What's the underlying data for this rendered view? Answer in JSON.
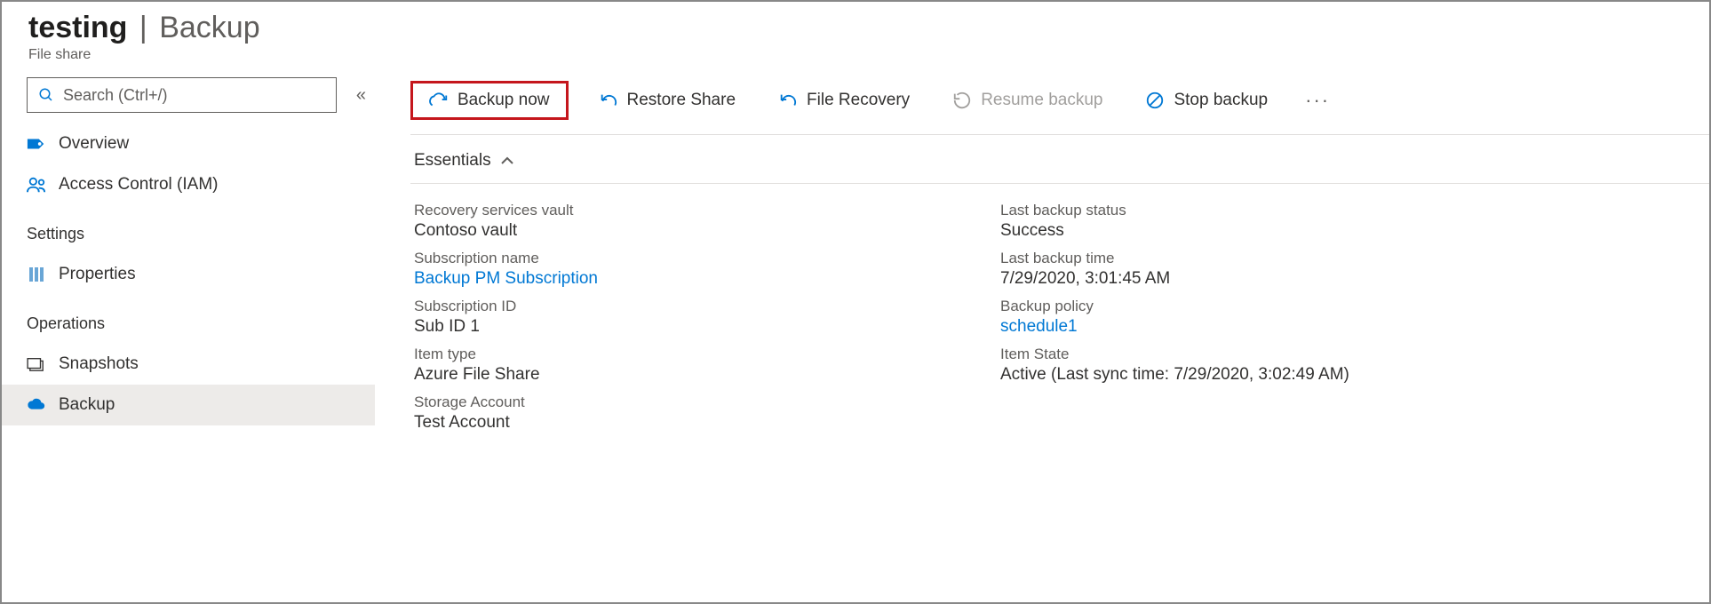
{
  "header": {
    "title_strong": "testing",
    "title_page": "Backup",
    "subtitle": "File share"
  },
  "search": {
    "placeholder": "Search (Ctrl+/)"
  },
  "sidebar": {
    "items": [
      {
        "label": "Overview",
        "icon": "tag-icon"
      },
      {
        "label": "Access Control (IAM)",
        "icon": "people-icon"
      }
    ],
    "group_settings": "Settings",
    "settings_items": [
      {
        "label": "Properties",
        "icon": "properties-icon"
      }
    ],
    "group_operations": "Operations",
    "operations_items": [
      {
        "label": "Snapshots",
        "icon": "snapshot-icon"
      },
      {
        "label": "Backup",
        "icon": "cloud-backup-icon",
        "selected": true
      }
    ]
  },
  "toolbar": {
    "backup_now": "Backup now",
    "restore_share": "Restore Share",
    "file_recovery": "File Recovery",
    "resume_backup": "Resume backup",
    "stop_backup": "Stop backup"
  },
  "essentials": {
    "heading": "Essentials",
    "left": [
      {
        "label": "Recovery services vault",
        "value": "Contoso vault",
        "link": false
      },
      {
        "label": "Subscription name",
        "value": "Backup PM Subscription",
        "link": true
      },
      {
        "label": "Subscription ID",
        "value": "Sub ID 1",
        "link": false
      },
      {
        "label": "Item type",
        "value": "Azure File Share",
        "link": false
      },
      {
        "label": "Storage Account",
        "value": "Test Account",
        "link": false
      }
    ],
    "right": [
      {
        "label": "Last backup status",
        "value": "Success",
        "link": false
      },
      {
        "label": "Last backup time",
        "value": "7/29/2020, 3:01:45 AM",
        "link": false
      },
      {
        "label": "Backup policy",
        "value": "schedule1",
        "link": true
      },
      {
        "label": "Item State",
        "value": "Active (Last sync time: 7/29/2020, 3:02:49 AM)",
        "link": false
      }
    ]
  }
}
